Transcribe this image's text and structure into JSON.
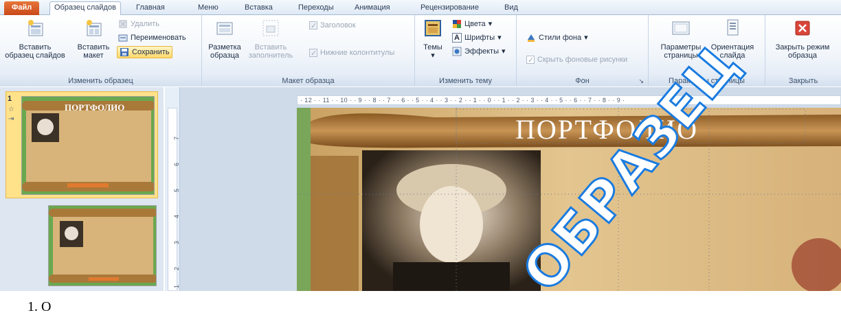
{
  "tabs": [
    {
      "label": "Файл",
      "active": false
    },
    {
      "label": "Образец слайдов",
      "active": true
    },
    {
      "label": "Главная",
      "active": false
    },
    {
      "label": "Меню",
      "active": false
    },
    {
      "label": "Вставка",
      "active": false
    },
    {
      "label": "Переходы",
      "active": false
    },
    {
      "label": "Анимация",
      "active": false
    },
    {
      "label": "Рецензирование",
      "active": false
    },
    {
      "label": "Вид",
      "active": false
    }
  ],
  "ribbon": {
    "edit_master": {
      "label": "Изменить образец",
      "insert_master_line1": "Вставить",
      "insert_master_line2": "образец слайдов",
      "insert_layout_line1": "Вставить",
      "insert_layout_line2": "макет",
      "delete": "Удалить",
      "rename": "Переименовать",
      "save": "Сохранить"
    },
    "master_layout": {
      "label": "Макет образца",
      "layout_line1": "Разметка",
      "layout_line2": "образца",
      "placeholder_line1": "Вставить",
      "placeholder_line2": "заполнитель",
      "title_chk": "Заголовок",
      "footers_chk": "Нижние колонтитулы"
    },
    "edit_theme": {
      "label": "Изменить тему",
      "themes": "Темы",
      "colors": "Цвета",
      "fonts": "Шрифты",
      "effects": "Эффекты"
    },
    "background": {
      "label": "Фон",
      "bg_styles": "Стили фона",
      "hide_bg": "Скрыть фоновые рисунки"
    },
    "page_setup": {
      "label": "Параметры страницы",
      "page_params_line1": "Параметры",
      "page_params_line2": "страницы",
      "orientation_line1": "Ориентация",
      "orientation_line2": "слайда"
    },
    "close": {
      "label": "Закрыть",
      "close_line1": "Закрыть режим",
      "close_line2": "образца"
    }
  },
  "slides": {
    "current_number": "1",
    "thumb_title": "ПОРТФОЛИО"
  },
  "ruler": {
    "horizontal": "· 12 · · 11 · · 10 · · 9 · · 8 · · 7 · · 6 · · 5 · · 4 · · 3 · · 2 · · 1 · · 0 · · 1 · · 2 · · 3 · · 4 · · 5 · · 6 · · 7 · · 8 · · 9 ·",
    "vertical": [
      "7",
      "6",
      "5",
      "4",
      "3",
      "2",
      "1"
    ]
  },
  "slide_main": {
    "title": "ПОРТФОЛИО"
  },
  "watermark": "ОБРАЗЕЦ",
  "caption": "1.  О"
}
